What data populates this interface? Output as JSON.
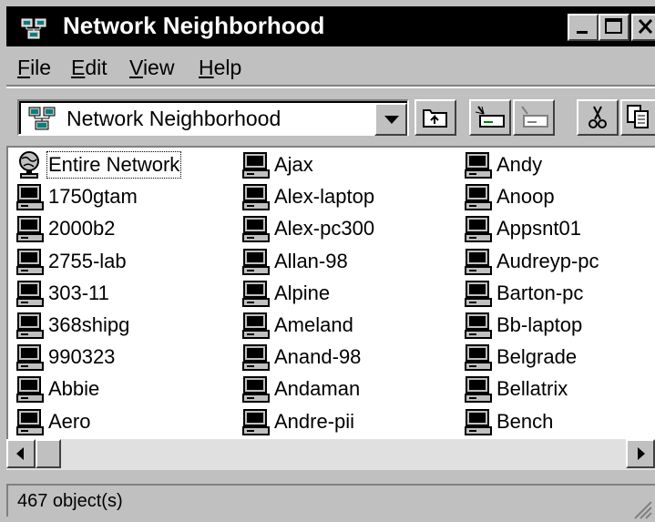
{
  "window": {
    "title": "Network Neighborhood",
    "title_bar_color": "#000000",
    "face_color": "#c0c0c0"
  },
  "menu": [
    {
      "label": "File",
      "accel": "F",
      "rest": "ile"
    },
    {
      "label": "Edit",
      "accel": "E",
      "rest": "dit"
    },
    {
      "label": "View",
      "accel": "V",
      "rest": "iew"
    },
    {
      "label": "Help",
      "accel": "H",
      "rest": "elp"
    }
  ],
  "toolbar": {
    "address_value": "Network Neighborhood",
    "buttons": [
      "up-one-level-icon",
      "map-network-drive-icon",
      "disconnect-network-drive-icon",
      "cut-icon",
      "copy-icon"
    ]
  },
  "items": {
    "col1": [
      "Entire Network",
      "1750gtam",
      "2000b2",
      "2755-lab",
      "303-11",
      "368shipg",
      "990323",
      "Abbie",
      "Aero"
    ],
    "col2": [
      "Ajax",
      "Alex-laptop",
      "Alex-pc300",
      "Allan-98",
      "Alpine",
      "Ameland",
      "Anand-98",
      "Andaman",
      "Andre-pii"
    ],
    "col3": [
      "Andy",
      "Anoop",
      "Appsnt01",
      "Audreyp-pc",
      "Barton-pc",
      "Bb-laptop",
      "Belgrade",
      "Bellatrix",
      "Bench"
    ]
  },
  "status": {
    "text": "467 object(s)"
  }
}
